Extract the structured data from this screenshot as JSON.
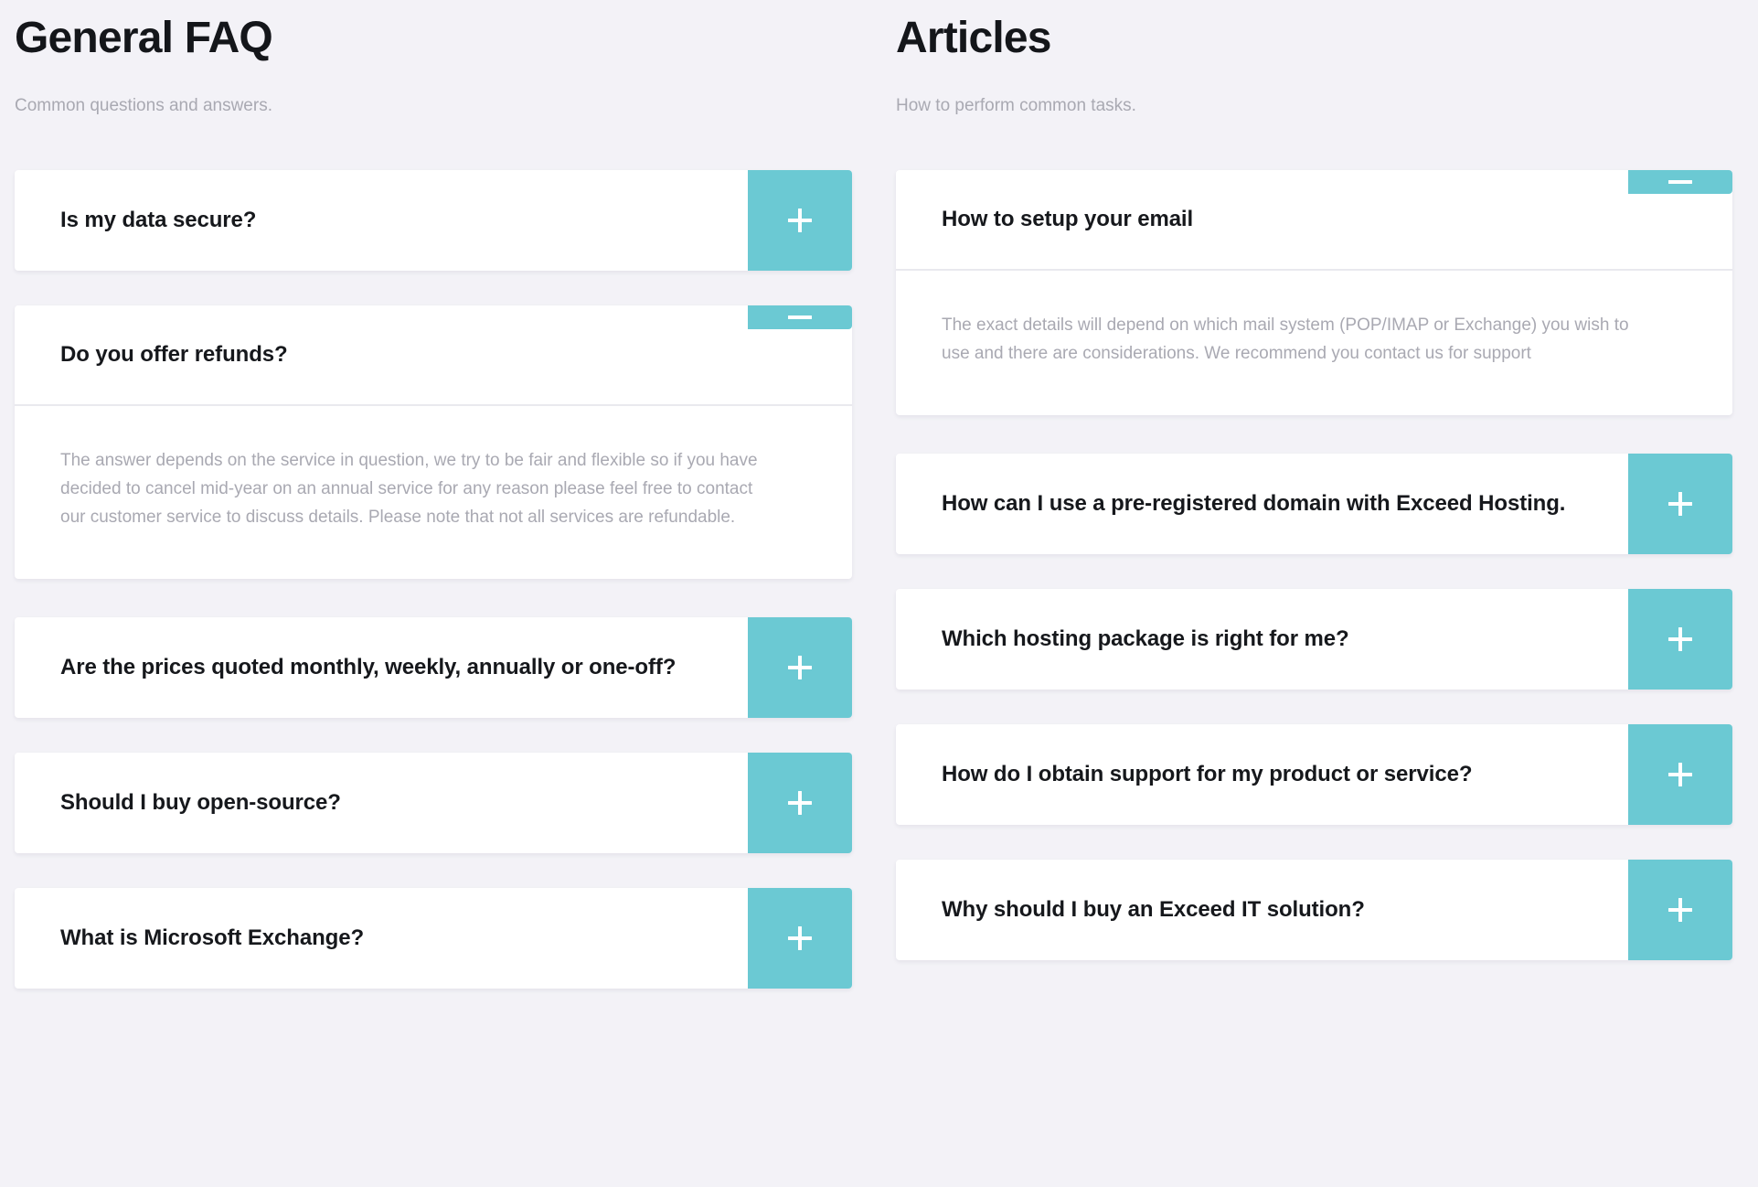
{
  "theme": {
    "accent": "#6BC9D3",
    "background": "#F3F2F7",
    "card": "#FFFFFF",
    "heading_text": "#16181C",
    "body_text": "#A9A9B2"
  },
  "columns": [
    {
      "key": "faq",
      "title": "General FAQ",
      "subtitle": "Common questions and answers.",
      "items": [
        {
          "question": "Is my data secure?",
          "expanded": false,
          "toggle_icon": "plus-icon",
          "answer": ""
        },
        {
          "question": "Do you offer refunds?",
          "expanded": true,
          "toggle_icon": "minus-icon",
          "answer": "The answer depends on the service in question, we try to be fair and flexible so if you have decided to cancel mid-year on an annual service for any reason please feel free to contact our customer service to discuss details. Please note that not all services are refundable."
        },
        {
          "question": "Are the prices quoted monthly, weekly, annually or one-off?",
          "expanded": false,
          "toggle_icon": "plus-icon",
          "answer": ""
        },
        {
          "question": "Should I buy open-source?",
          "expanded": false,
          "toggle_icon": "plus-icon",
          "answer": ""
        },
        {
          "question": "What is Microsoft Exchange?",
          "expanded": false,
          "toggle_icon": "plus-icon",
          "answer": ""
        }
      ]
    },
    {
      "key": "articles",
      "title": "Articles",
      "subtitle": "How to perform common tasks.",
      "items": [
        {
          "question": "How to setup your email",
          "expanded": true,
          "toggle_icon": "minus-icon",
          "answer": "The exact details will depend on which mail system (POP/IMAP or Exchange) you wish to use and there are considerations. We recommend you contact us for support"
        },
        {
          "question": "How can I use a pre-registered domain with Exceed Hosting.",
          "expanded": false,
          "toggle_icon": "plus-icon",
          "answer": ""
        },
        {
          "question": "Which hosting package is right for me?",
          "expanded": false,
          "toggle_icon": "plus-icon",
          "answer": ""
        },
        {
          "question": "How do I obtain support for my product or service?",
          "expanded": false,
          "toggle_icon": "plus-icon",
          "answer": ""
        },
        {
          "question": "Why should I buy an Exceed IT solution?",
          "expanded": false,
          "toggle_icon": "plus-icon",
          "answer": ""
        }
      ]
    }
  ]
}
